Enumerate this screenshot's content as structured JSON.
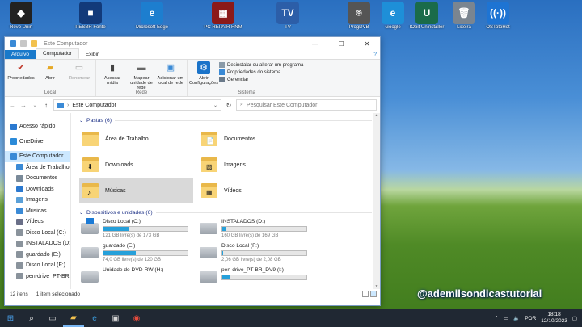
{
  "desktop_icons": [
    {
      "label": "Revo Unin",
      "color": "#222222",
      "glyph": "◆"
    },
    {
      "label": "PESBR Fonte",
      "color": "#123a7a",
      "glyph": "■"
    },
    {
      "label": "Microsoft Edge",
      "color": "#1d7ecf",
      "glyph": "e"
    },
    {
      "label": "PC REPAIR RNM",
      "color": "#8b1a1a",
      "glyph": "▦"
    },
    {
      "label": "TV",
      "color": "#2c5ea8",
      "glyph": "TV"
    },
    {
      "label": "ProgDVB",
      "color": "#555555",
      "glyph": "⌾"
    },
    {
      "label": "Google",
      "color": "#1e8fd8",
      "glyph": "e"
    },
    {
      "label": "IObit Uninstaller",
      "color": "#1a6b4a",
      "glyph": "U"
    },
    {
      "label": "Lixeira",
      "color": "#7a8590",
      "glyph": "🗑"
    },
    {
      "label": "OSTotoHot",
      "color": "#1e74d3",
      "glyph": "((·))"
    }
  ],
  "window": {
    "title": "Este Computador",
    "minimize": "—",
    "maximize": "☐",
    "close": "✕"
  },
  "ribbon_tabs": {
    "file": "Arquivo",
    "computer": "Computador",
    "view": "Exibir",
    "help": "?"
  },
  "ribbon": {
    "local": {
      "name": "Local",
      "properties": "Propriedades",
      "open": "Abrir",
      "rename": "Renomear"
    },
    "network": {
      "name": "Rede",
      "media": "Acessar mídia",
      "map_drive": "Mapear unidade de rede",
      "add_location": "Adicionar um local de rede"
    },
    "system": {
      "name": "Sistema",
      "open_settings": "Abrir Configurações",
      "uninstall": "Desinstalar ou alterar um programa",
      "system_props": "Propriedades do sistema",
      "manage": "Gerenciar"
    }
  },
  "address": {
    "path": "Este Computador",
    "search_placeholder": "Pesquisar Este Computador"
  },
  "nav": [
    {
      "label": "Acesso rápido",
      "color": "#2b79d0"
    },
    {
      "label": "OneDrive",
      "color": "#2b8ad8"
    },
    {
      "label": "Este Computador",
      "color": "#3a8ad6"
    },
    {
      "label": "Área de Trabalho",
      "color": "#3a8ad6"
    },
    {
      "label": "Documentos",
      "color": "#7a8a99"
    },
    {
      "label": "Downloads",
      "color": "#2b79d0"
    },
    {
      "label": "Imagens",
      "color": "#5aa0d8"
    },
    {
      "label": "Músicas",
      "color": "#3a8ad6"
    },
    {
      "label": "Vídeos",
      "color": "#6a6f88"
    },
    {
      "label": "Disco Local (C:)",
      "color": "#8a939c"
    },
    {
      "label": "INSTALADOS (D:)",
      "color": "#8a939c"
    },
    {
      "label": "guardado (E:)",
      "color": "#8a939c"
    },
    {
      "label": "Disco Local (F:)",
      "color": "#8a939c"
    },
    {
      "label": "pen-drive_PT-BR",
      "color": "#8a939c"
    }
  ],
  "folders_header": "Pastas (6)",
  "folders": [
    {
      "name": "Área de Trabalho",
      "badge": ""
    },
    {
      "name": "Documentos",
      "badge": "📄"
    },
    {
      "name": "Downloads",
      "badge": "⬇"
    },
    {
      "name": "Imagens",
      "badge": "▧"
    },
    {
      "name": "Músicas",
      "badge": "♪"
    },
    {
      "name": "Vídeos",
      "badge": "▦"
    }
  ],
  "drives_header": "Dispositivos e unidades (6)",
  "drives": [
    {
      "name": "Disco Local (C:)",
      "free": "121 GB livre(s) de 173 GB",
      "used_fraction": 0.3,
      "system": true
    },
    {
      "name": "INSTALADOS (D:)",
      "free": "160 GB livre(s) de 169 GB",
      "used_fraction": 0.05,
      "system": false
    },
    {
      "name": "guardado (E:)",
      "free": "74,0 GB livre(s) de 120 GB",
      "used_fraction": 0.38,
      "system": false
    },
    {
      "name": "Disco Local (F:)",
      "free": "2,06 GB livre(s) de 2,08 GB",
      "used_fraction": 0.01,
      "system": false
    },
    {
      "name": "Unidade de DVD-RW (H:)",
      "free": "",
      "used_fraction": null,
      "system": false
    },
    {
      "name": "pen-drive_PT-BR_DV9 (I:)",
      "free": "",
      "used_fraction": 0.1,
      "system": false
    }
  ],
  "status": {
    "items": "12 itens",
    "selected": "1 item selecionado"
  },
  "watermark": "@ademilsondicastutorial",
  "taskbar": {
    "lang": "POR",
    "time": "18:18",
    "date": "12/10/2023"
  }
}
